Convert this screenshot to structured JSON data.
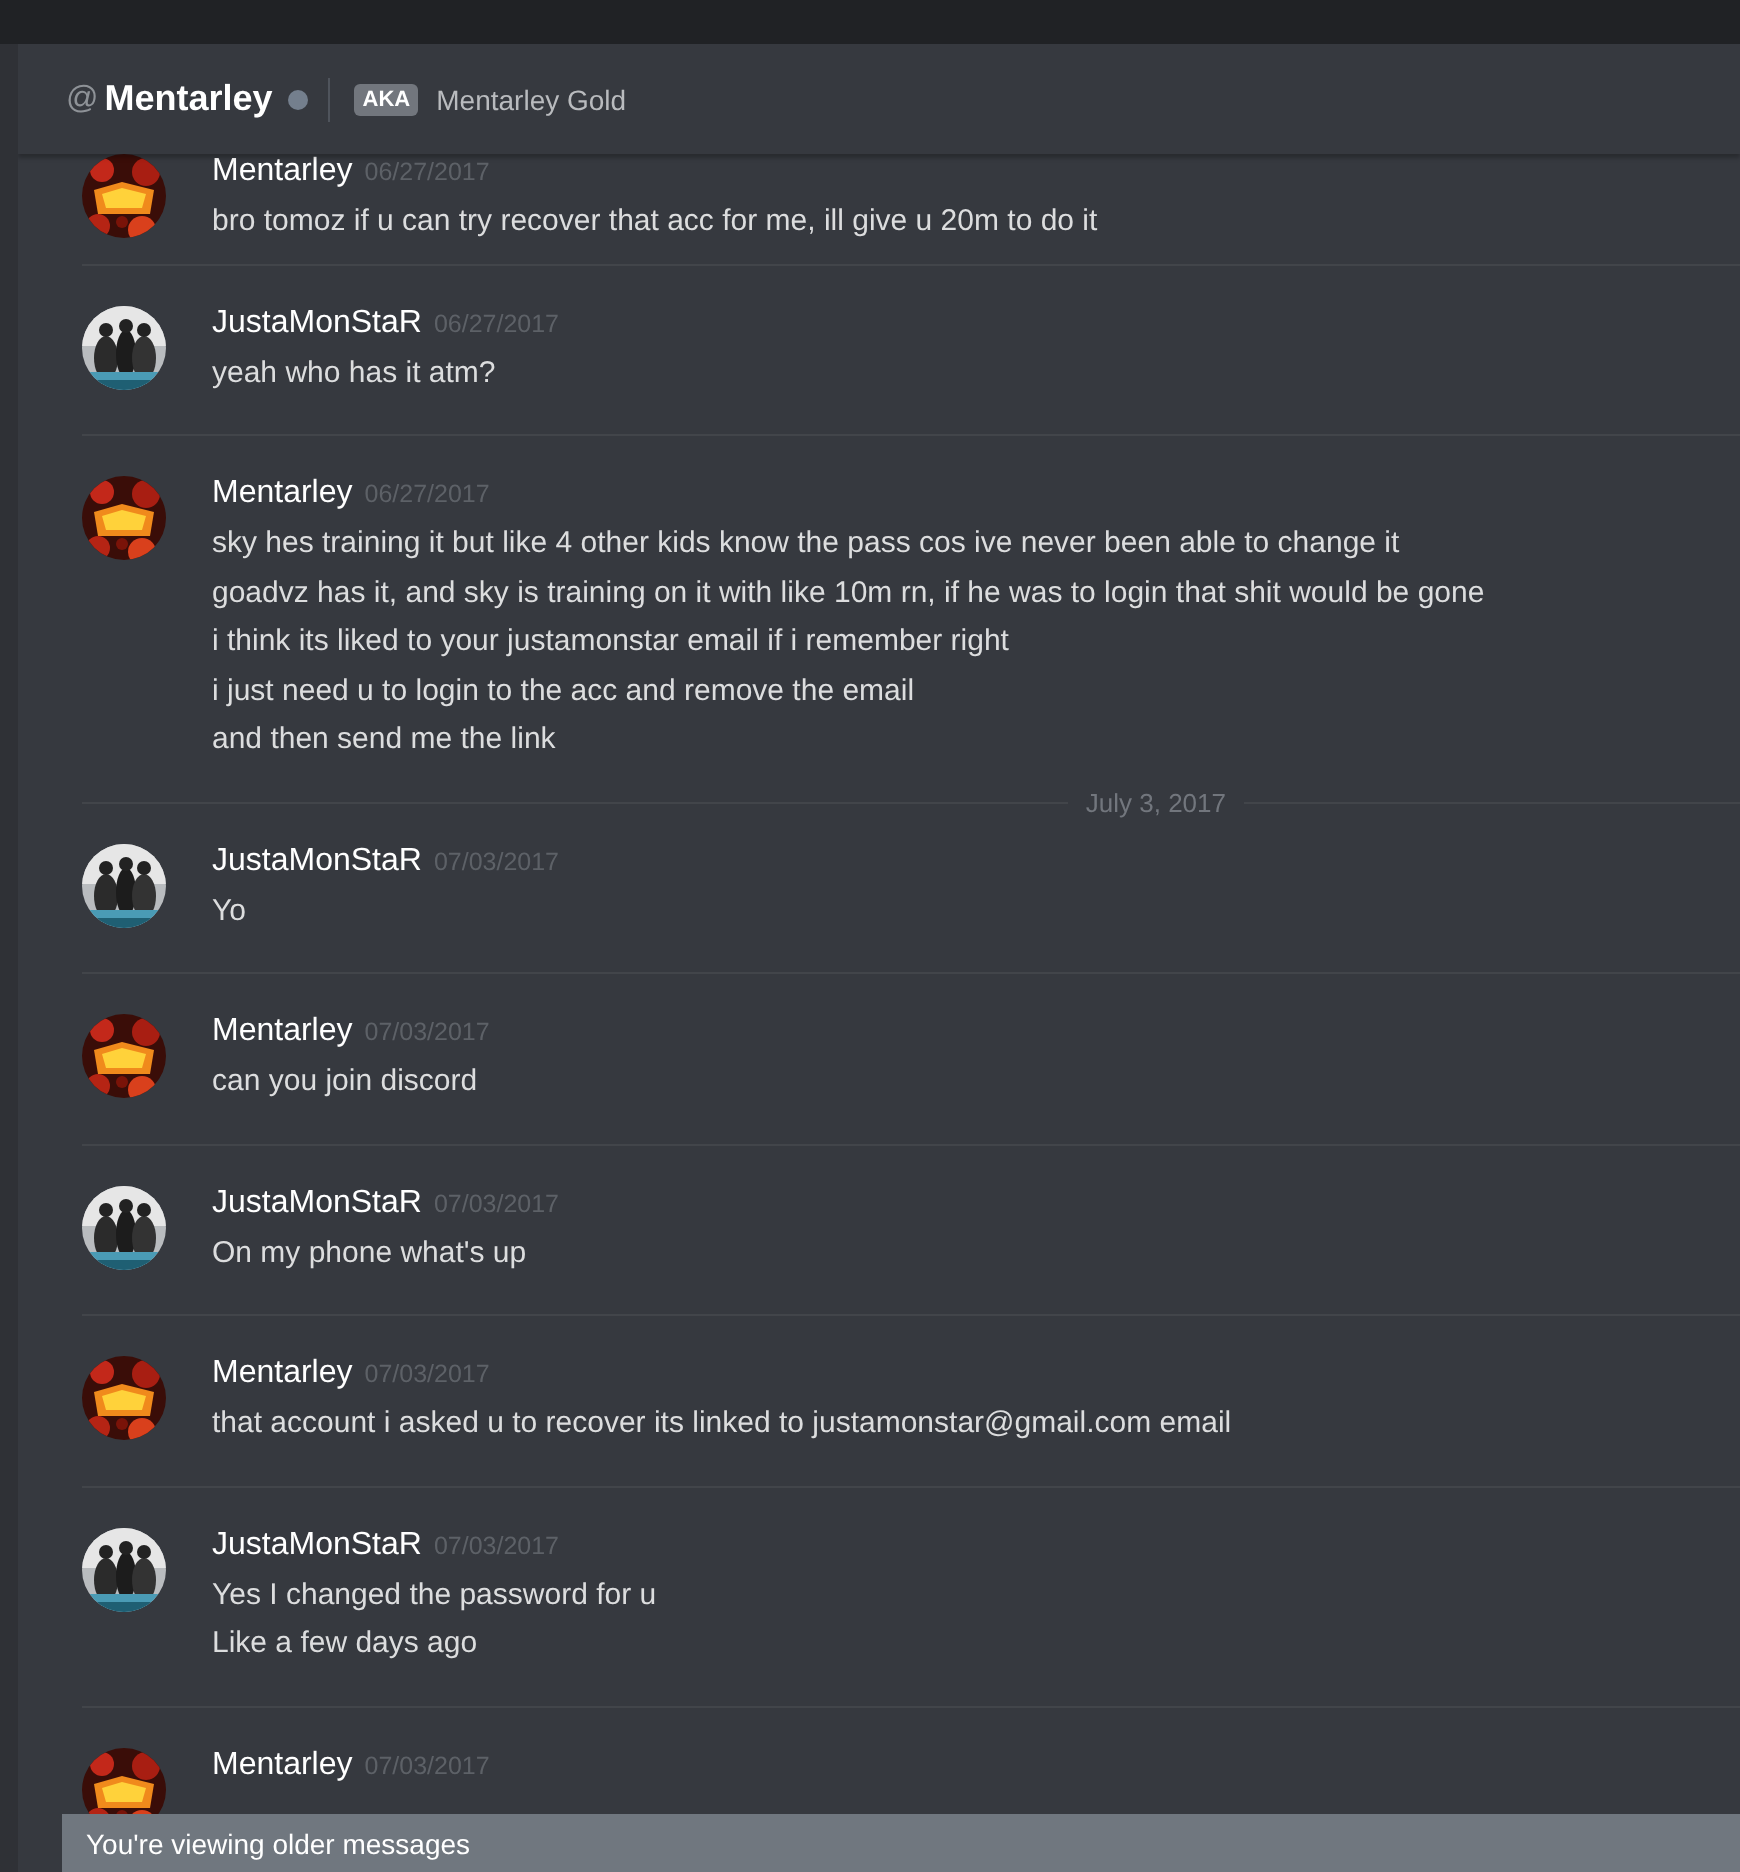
{
  "header": {
    "at": "@",
    "name": "Mentarley",
    "aka_badge": "AKA",
    "aka_name": "Mentarley Gold"
  },
  "messages": [
    {
      "kind": "message",
      "author": "Mentarley",
      "avatar": {
        "kind": "flame"
      },
      "timestamp": "06/27/2017",
      "lines": [
        "bro tomoz if u can try recover that acc for me, ill give u 20m to do it"
      ]
    },
    {
      "kind": "message",
      "author": "JustaMonStaR",
      "avatar": {
        "kind": "group"
      },
      "timestamp": "06/27/2017",
      "lines": [
        "yeah who has it atm?"
      ]
    },
    {
      "kind": "message",
      "author": "Mentarley",
      "avatar": {
        "kind": "flame"
      },
      "timestamp": "06/27/2017",
      "lines": [
        "sky hes training it but like 4 other kids know the pass cos ive never been able to change it",
        "goadvz has it, and sky is training on it with like 10m rn, if he was to login that shit would be gone",
        "i think its liked to your justamonstar email if i remember right",
        "i just need u to login to the acc and remove the email",
        "and then send me the link"
      ]
    },
    {
      "kind": "date_divider",
      "label": "July 3, 2017"
    },
    {
      "kind": "message",
      "author": "JustaMonStaR",
      "avatar": {
        "kind": "group"
      },
      "timestamp": "07/03/2017",
      "lines": [
        "Yo"
      ]
    },
    {
      "kind": "message",
      "author": "Mentarley",
      "avatar": {
        "kind": "flame"
      },
      "timestamp": "07/03/2017",
      "lines": [
        "can you join discord"
      ]
    },
    {
      "kind": "message",
      "author": "JustaMonStaR",
      "avatar": {
        "kind": "group"
      },
      "timestamp": "07/03/2017",
      "lines": [
        "On my phone what's up"
      ]
    },
    {
      "kind": "message",
      "author": "Mentarley",
      "avatar": {
        "kind": "flame"
      },
      "timestamp": "07/03/2017",
      "lines": [
        "that account i asked u to recover its linked to justamonstar@gmail.com email"
      ]
    },
    {
      "kind": "message",
      "author": "JustaMonStaR",
      "avatar": {
        "kind": "group"
      },
      "timestamp": "07/03/2017",
      "lines": [
        "Yes I changed the password for u",
        "Like a few days ago"
      ]
    },
    {
      "kind": "message",
      "author": "Mentarley",
      "avatar": {
        "kind": "flame"
      },
      "timestamp": "07/03/2017"
    }
  ],
  "banner": "You're viewing older messages"
}
